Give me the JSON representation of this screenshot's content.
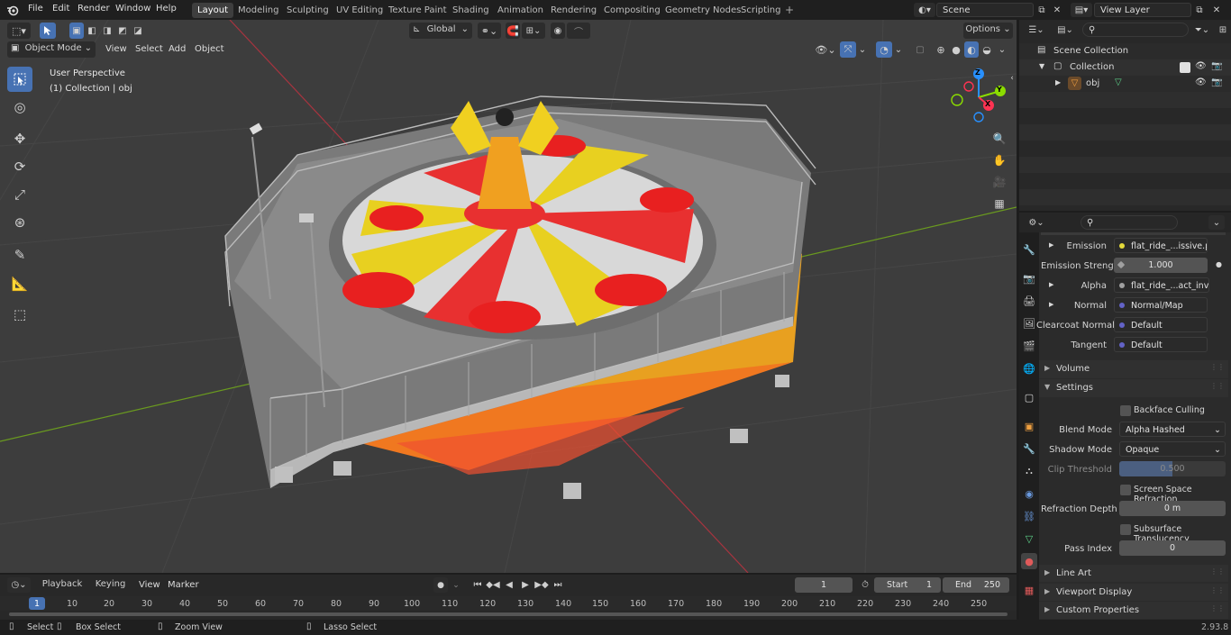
{
  "topbar": {
    "menus": [
      "File",
      "Edit",
      "Render",
      "Window",
      "Help"
    ],
    "workspaces": [
      "Layout",
      "Modeling",
      "Sculpting",
      "UV Editing",
      "Texture Paint",
      "Shading",
      "Animation",
      "Rendering",
      "Compositing",
      "Geometry Nodes",
      "Scripting"
    ],
    "scene": "Scene",
    "view_layer": "View Layer"
  },
  "viewport": {
    "mode": "Object Mode",
    "menus": [
      "View",
      "Select",
      "Add",
      "Object"
    ],
    "orientation": "Global",
    "options": "Options",
    "perspective": "User Perspective",
    "collection_info": "(1) Collection | obj",
    "gizmo": {
      "x": "X",
      "y": "Y",
      "z": "Z"
    }
  },
  "outliner": {
    "scene_collection": "Scene Collection",
    "collection": "Collection",
    "object": "obj"
  },
  "properties": {
    "emission_label": "Emission",
    "emission_value": "flat_ride_...issive.png",
    "emission_strength_label": "Emission Strengt",
    "emission_strength_value": "1.000",
    "alpha_label": "Alpha",
    "alpha_value": "flat_ride_...act_inv.png",
    "normal_label": "Normal",
    "normal_value": "Normal/Map",
    "clearcoat_label": "Clearcoat Normal",
    "clearcoat_value": "Default",
    "tangent_label": "Tangent",
    "tangent_value": "Default",
    "volume": "Volume",
    "settings": "Settings",
    "backface": "Backface Culling",
    "blend_mode_label": "Blend Mode",
    "blend_mode_value": "Alpha Hashed",
    "shadow_mode_label": "Shadow Mode",
    "shadow_mode_value": "Opaque",
    "clip_label": "Clip Threshold",
    "clip_value": "0.500",
    "ssr": "Screen Space Refraction",
    "refraction_label": "Refraction Depth",
    "refraction_value": "0 m",
    "subsurface": "Subsurface Translucency",
    "pass_index_label": "Pass Index",
    "pass_index_value": "0",
    "line_art": "Line Art",
    "viewport_display": "Viewport Display",
    "custom_properties": "Custom Properties"
  },
  "timeline": {
    "menus": [
      "Playback",
      "Keying",
      "View",
      "Marker"
    ],
    "current_frame": "1",
    "start_label": "Start",
    "start_value": "1",
    "end_label": "End",
    "end_value": "250",
    "ticks": [
      "1",
      "10",
      "20",
      "30",
      "40",
      "50",
      "60",
      "70",
      "80",
      "90",
      "100",
      "110",
      "120",
      "130",
      "140",
      "150",
      "160",
      "170",
      "180",
      "190",
      "200",
      "210",
      "220",
      "230",
      "240",
      "250"
    ]
  },
  "statusbar": {
    "select": "Select",
    "box_select": "Box Select",
    "zoom_view": "Zoom View",
    "lasso_select": "Lasso Select",
    "version": "2.93.8"
  },
  "colors": {
    "accent": "#4772b3",
    "x_axis": "#ff3352",
    "y_axis": "#8bdc00",
    "z_axis": "#2890ff"
  }
}
